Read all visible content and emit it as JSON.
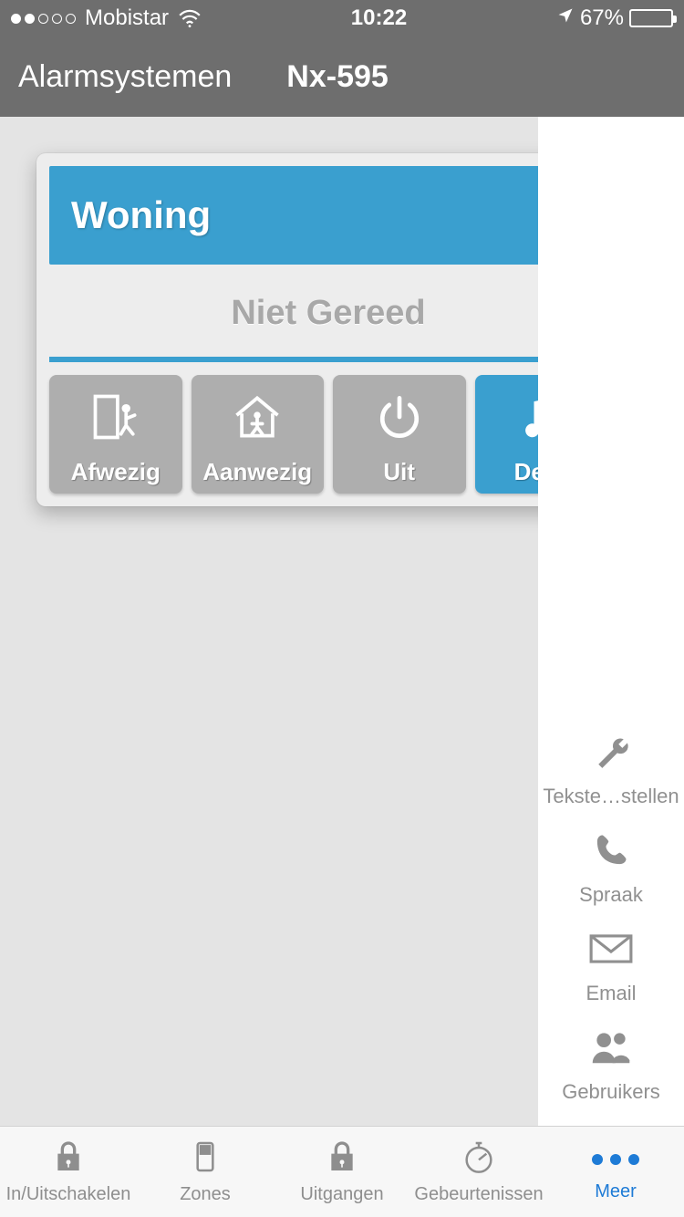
{
  "status": {
    "carrier": "Mobistar",
    "time": "10:22",
    "battery_pct": "67%"
  },
  "nav": {
    "back_label": "Alarmsystemen",
    "title": "Nx-595"
  },
  "card": {
    "title": "Woning",
    "status_text": "Niet Gereed"
  },
  "actions": {
    "away": "Afwezig",
    "home": "Aanwezig",
    "off": "Uit",
    "chime": "Deur"
  },
  "drawer": {
    "texts": "Tekste…stellen",
    "voice": "Spraak",
    "email": "Email",
    "users": "Gebruikers"
  },
  "tabs": {
    "arm": "In/Uitschakelen",
    "zones": "Zones",
    "outputs": "Uitgangen",
    "events": "Gebeurtenissen",
    "more": "Meer"
  }
}
